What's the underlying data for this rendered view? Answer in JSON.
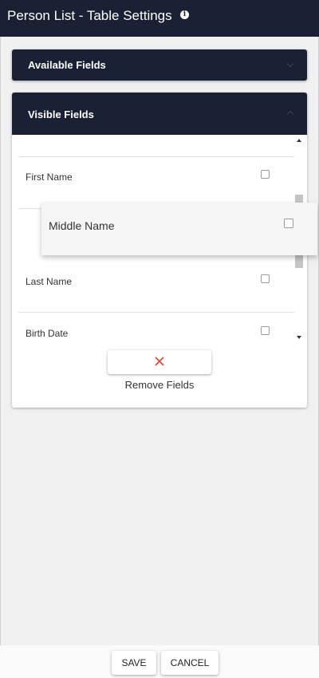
{
  "header": {
    "title": "Person List - Table Settings",
    "info_icon": "info-icon",
    "info_glyph": "i"
  },
  "panels": {
    "available": {
      "label": "Available Fields",
      "icon": "chevron-down-icon"
    },
    "visible": {
      "label": "Visible Fields",
      "icon": "chevron-up-icon"
    }
  },
  "visible_fields": [
    {
      "label": "First Name",
      "checked": false
    },
    {
      "label": "Last Name",
      "checked": false
    },
    {
      "label": "Birth Date",
      "checked": false
    }
  ],
  "dragging_item": {
    "label": "Middle Name",
    "checked": false
  },
  "remove": {
    "label": "Remove Fields",
    "icon": "close-icon",
    "icon_color": "#e04a3a"
  },
  "footer": {
    "save_label": "SAVE",
    "cancel_label": "CANCEL"
  },
  "colors": {
    "header_bg": "#1b2134",
    "page_bg": "#f0f0f0"
  }
}
